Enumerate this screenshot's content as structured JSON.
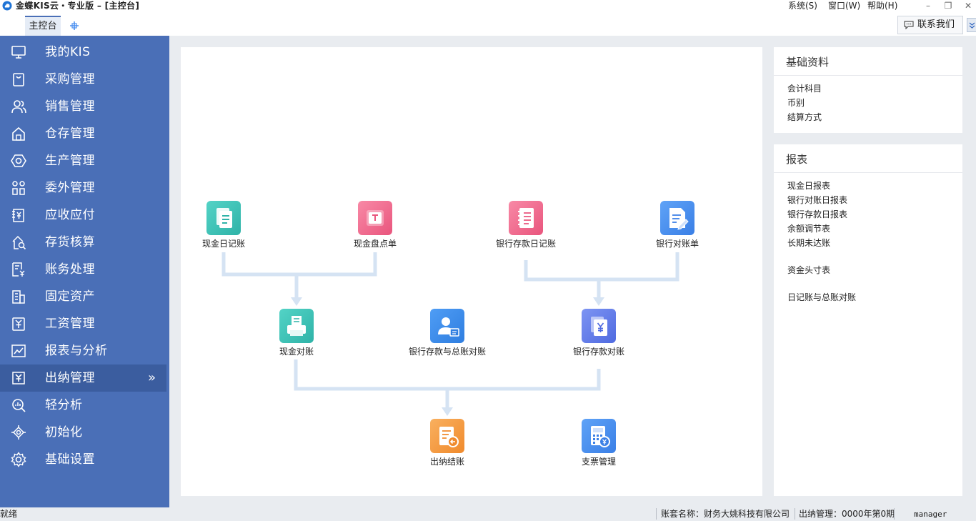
{
  "window": {
    "title": "金蝶KIS云・专业版 – [主控台]",
    "menu": [
      "系统(S)",
      "窗口(W)",
      "帮助(H)"
    ]
  },
  "tabs": {
    "active_label": "主控台",
    "contact_label": "联系我们"
  },
  "sidebar": {
    "items": [
      {
        "label": "我的KIS",
        "icon": "monitor-icon"
      },
      {
        "label": "采购管理",
        "icon": "shopping-bag-icon"
      },
      {
        "label": "销售管理",
        "icon": "users-icon"
      },
      {
        "label": "仓存管理",
        "icon": "warehouse-icon"
      },
      {
        "label": "生产管理",
        "icon": "hexagon-gear-icon"
      },
      {
        "label": "委外管理",
        "icon": "outsource-icon"
      },
      {
        "label": "应收应付",
        "icon": "yen-book-icon"
      },
      {
        "label": "存货核算",
        "icon": "inventory-search-icon"
      },
      {
        "label": "账务处理",
        "icon": "ledger-yen-icon"
      },
      {
        "label": "固定资产",
        "icon": "building-icon"
      },
      {
        "label": "工资管理",
        "icon": "payroll-icon"
      },
      {
        "label": "报表与分析",
        "icon": "trend-chart-icon"
      },
      {
        "label": "出纳管理",
        "icon": "cashier-yen-icon",
        "active": true
      },
      {
        "label": "轻分析",
        "icon": "magnifier-chart-icon"
      },
      {
        "label": "初始化",
        "icon": "target-gear-icon"
      },
      {
        "label": "基础设置",
        "icon": "settings-gear-icon"
      }
    ]
  },
  "flow": {
    "nodes": [
      {
        "id": "cash-journal",
        "label": "现金日记账",
        "color": "#3cc4b8",
        "icon": "document-lines-icon"
      },
      {
        "id": "cash-count",
        "label": "现金盘点单",
        "color": "#f06a8e",
        "icon": "cash-count-icon"
      },
      {
        "id": "bank-journal",
        "label": "银行存款日记账",
        "color": "#f06a8e",
        "icon": "notebook-icon"
      },
      {
        "id": "bank-statement",
        "label": "银行对账单",
        "color": "#4a8ff0",
        "icon": "statement-pen-icon"
      },
      {
        "id": "cash-reconcile",
        "label": "现金对账",
        "color": "#3cc4b8",
        "icon": "printer-icon"
      },
      {
        "id": "bank-gl-reconcile",
        "label": "银行存款与总账对账",
        "color": "#3a8ee8",
        "icon": "user-card-icon"
      },
      {
        "id": "bank-reconcile",
        "label": "银行存款对账",
        "color": "#5b78e8",
        "icon": "yen-docs-icon"
      },
      {
        "id": "cashier-close",
        "label": "出纳结账",
        "color": "#f59a3e",
        "icon": "close-out-icon"
      },
      {
        "id": "cheque-mgmt",
        "label": "支票管理",
        "color": "#3a8ee8",
        "icon": "calculator-yen-icon"
      }
    ]
  },
  "panels": {
    "basic": {
      "title": "基础资料",
      "links": [
        "会计科目",
        "币别",
        "结算方式"
      ]
    },
    "reports": {
      "title": "报表",
      "links": [
        "现金日报表",
        "银行对账日报表",
        "银行存款日报表",
        "余额调节表",
        "长期未达账",
        "资金头寸表",
        "日记账与总账对账"
      ]
    }
  },
  "statusbar": {
    "status": "就绪",
    "account": "账套名称：财务大姚科技有限公司",
    "period": "出纳管理：0000年第0期",
    "user": "manager"
  },
  "colors": {
    "sidebar_bg": "#4a6fb7",
    "sidebar_active": "#3b5d9f",
    "connector": "#d5e3f3"
  }
}
